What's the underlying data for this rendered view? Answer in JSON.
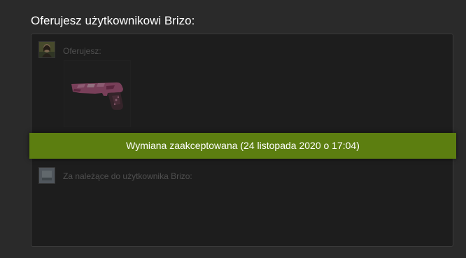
{
  "header": {
    "title": "Oferujesz użytkownikowi Brizo:"
  },
  "your_offer": {
    "label": "Oferujesz:",
    "items": [
      {
        "icon": "pistol-skin-icon"
      }
    ]
  },
  "their_offer": {
    "label": "Za należące do użytkownika Brizo:",
    "items": []
  },
  "status": {
    "text": "Wymiana zaakceptowana (24 listopada 2020 o 17:04)",
    "color": "#5c7e10"
  }
}
